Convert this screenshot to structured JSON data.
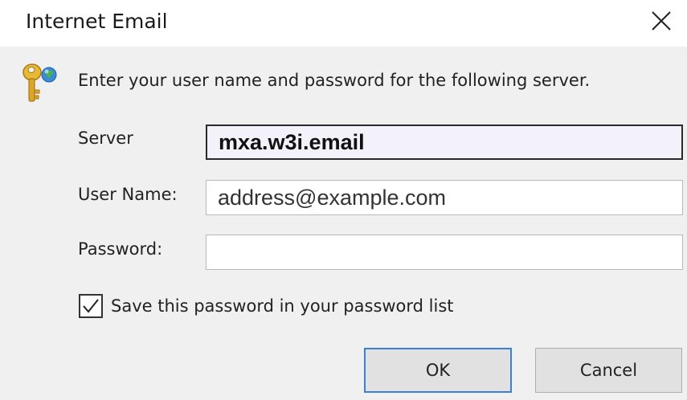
{
  "window": {
    "title": "Internet Email",
    "close_icon": "close-icon"
  },
  "prompt": {
    "icon": "key-icon",
    "message": "Enter your user name and password for the following server."
  },
  "fields": {
    "server": {
      "label": "Server",
      "value": "mxa.w3i.email"
    },
    "user_name": {
      "label": "User Name:",
      "value": "address@example.com"
    },
    "password": {
      "label": "Password:",
      "value": ""
    }
  },
  "save_password": {
    "label": "Save this password in your password list",
    "checked": true
  },
  "buttons": {
    "ok": "OK",
    "cancel": "Cancel"
  },
  "colors": {
    "default_button_border": "#3c7fd6",
    "key_gold": "#d9a62a",
    "arrow_blue": "#3a8ad6",
    "arrow_green": "#4caf50"
  }
}
